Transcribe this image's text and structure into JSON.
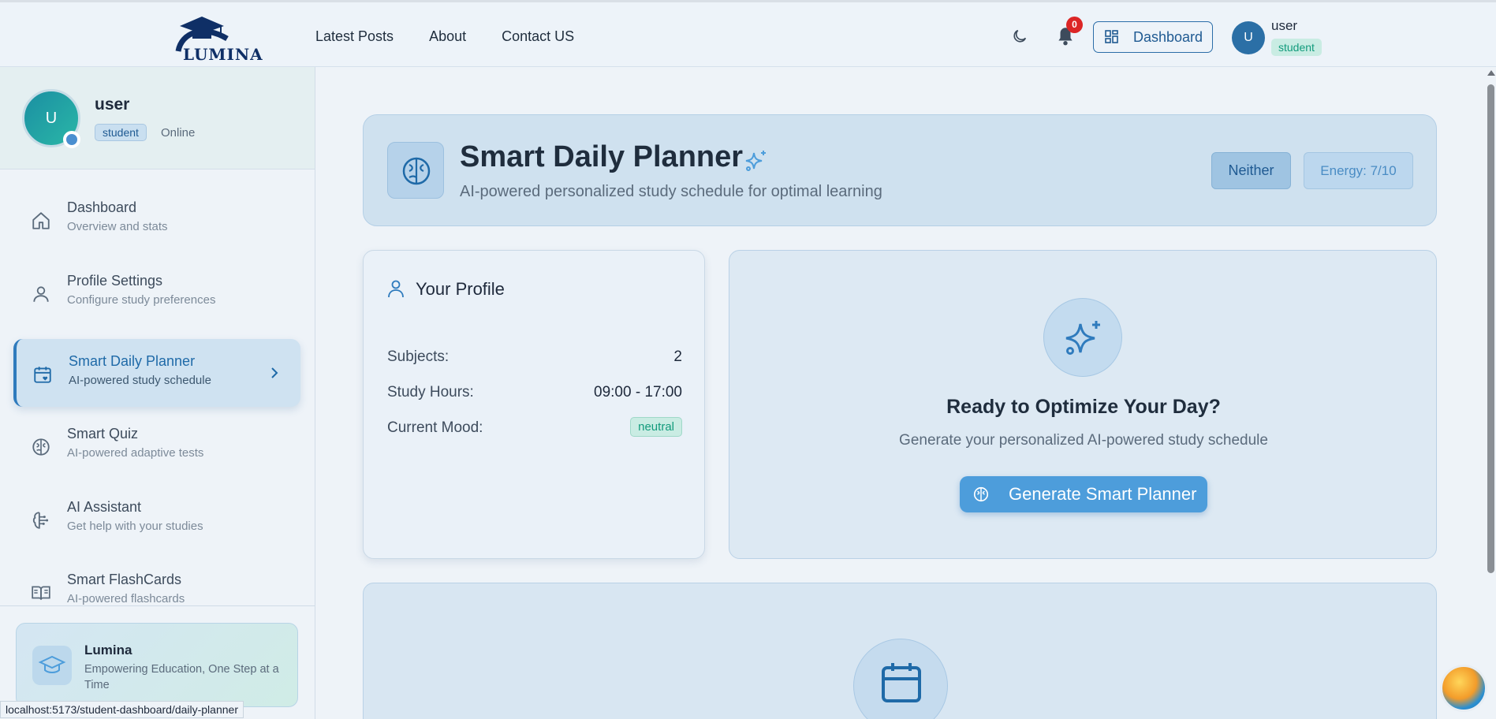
{
  "nav": {
    "logo_text": "LUMINA",
    "links": [
      "Latest Posts",
      "About",
      "Contact US"
    ],
    "notifications_count": "0",
    "dashboard_label": "Dashboard",
    "user_initial": "U",
    "user_name": "user",
    "user_role": "student"
  },
  "sidebar": {
    "profile": {
      "initial": "U",
      "name": "user",
      "role": "student",
      "status": "Online"
    },
    "items": [
      {
        "title": "Dashboard",
        "subtitle": "Overview and stats",
        "icon": "home-icon"
      },
      {
        "title": "Profile Settings",
        "subtitle": "Configure study preferences",
        "icon": "user-icon"
      },
      {
        "title": "Smart Daily Planner",
        "subtitle": "AI-powered study schedule",
        "icon": "calendar-heart-icon",
        "active": true
      },
      {
        "title": "Smart Quiz",
        "subtitle": "AI-powered adaptive tests",
        "icon": "brain-icon"
      },
      {
        "title": "AI Assistant",
        "subtitle": "Get help with your studies",
        "icon": "brain-circuit-icon"
      },
      {
        "title": "Smart FlashCards",
        "subtitle": "AI-powered flashcards",
        "icon": "book-open-icon"
      }
    ],
    "footer": {
      "title": "Lumina",
      "subtitle": "Empowering Education, One Step at a Time"
    }
  },
  "status_bar_url": "localhost:5173/student-dashboard/daily-planner",
  "hero": {
    "title": "Smart Daily Planner",
    "subtitle": "AI-powered personalized study schedule for optimal learning",
    "chronotype": "Neither",
    "energy": "Energy: 7/10"
  },
  "profile_card": {
    "title": "Your Profile",
    "rows": [
      {
        "label": "Subjects:",
        "value": "2"
      },
      {
        "label": "Study Hours:",
        "value": "09:00 - 17:00"
      },
      {
        "label": "Current Mood:",
        "value": "neutral"
      }
    ]
  },
  "ready_card": {
    "title": "Ready to Optimize Your Day?",
    "subtitle": "Generate your personalized AI-powered study schedule",
    "button_label": "Generate Smart Planner"
  },
  "colors": {
    "accent": "#2f7bbd",
    "primary_button": "#4d9ddb",
    "badge_green": "#129b7c",
    "alert": "#dc2626"
  }
}
